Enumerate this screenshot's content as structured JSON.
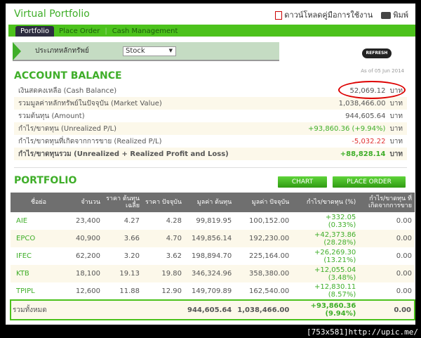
{
  "header": {
    "title": "Virtual Portfolio",
    "download_manual": "ดาวน์โหลดคู่มือการใช้งาน",
    "print": "พิมพ์"
  },
  "nav": {
    "tabs": [
      {
        "label": "Portfolio",
        "active": true
      },
      {
        "label": "Place Order"
      },
      {
        "label": "Cash Management"
      }
    ]
  },
  "filter": {
    "label": "ประเภทหลักทรัพย์",
    "selected": "Stock",
    "refresh": "REFRESH"
  },
  "account": {
    "heading": "ACCOUNT BALANCE",
    "as_of": "As of 05 Jun 2014",
    "unit": "บาท",
    "rows": [
      {
        "label": "เงินสดคงเหลือ (Cash Balance)",
        "value": "52,069.12"
      },
      {
        "label": "รวมมูลค่าหลักทรัพย์ในปัจจุบัน (Market Value)",
        "value": "1,038,466.00"
      },
      {
        "label": "รวมต้นทุน (Amount)",
        "value": "944,605.64"
      },
      {
        "label": "กำไร/ขาดทุน (Unrealized P/L)",
        "value": "+93,860.36 (+9.94%)"
      },
      {
        "label": "กำไร/ขาดทุนที่เกิดจากการขาย (Realized P/L)",
        "value": "-5,032.22"
      },
      {
        "label": "กำไร/ขาดทุนรวม (Unrealized + Realized Profit and Loss)",
        "value": "+88,828.14"
      }
    ]
  },
  "portfolio": {
    "heading": "PORTFOLIO",
    "chart_button": "CHART",
    "place_order_button": "PLACE ORDER",
    "columns": [
      "ชื่อย่อ",
      "จำนวน",
      "ราคา ต้นทุนเฉลี่ย",
      "ราคา ปัจจุบัน",
      "มูลค่า ต้นทุน",
      "มูลค่า ปัจจุบัน",
      "กำไร/ขาดทุน (%)",
      "กำไร/ขาดทุน ที่เกิดจากการขาย"
    ],
    "rows": [
      [
        "AIE",
        "23,400",
        "4.27",
        "4.28",
        "99,819.95",
        "100,152.00",
        "+332.05",
        "(0.33%)",
        "0.00"
      ],
      [
        "EPCO",
        "40,900",
        "3.66",
        "4.70",
        "149,856.14",
        "192,230.00",
        "+42,373.86",
        "(28.28%)",
        "0.00"
      ],
      [
        "IFEC",
        "62,200",
        "3.20",
        "3.62",
        "198,894.70",
        "225,164.00",
        "+26,269.30",
        "(13.21%)",
        "0.00"
      ],
      [
        "KTB",
        "18,100",
        "19.13",
        "19.80",
        "346,324.96",
        "358,380.00",
        "+12,055.04",
        "(3.48%)",
        "0.00"
      ],
      [
        "TPIPL",
        "12,600",
        "11.88",
        "12.90",
        "149,709.89",
        "162,540.00",
        "+12,830.11",
        "(8.57%)",
        "0.00"
      ]
    ],
    "total": {
      "label": "รวมทั้งหมด",
      "cost": "944,605.64",
      "market": "1,038,466.00",
      "pl": "+93,860.36",
      "pct": "(9.94%)",
      "realized": "0.00"
    }
  },
  "footer": "[753x581]http://upic.me/",
  "colors": {
    "accent": "#3fae29",
    "nav": "#4cc21c",
    "header_bg": "#6f6f6f",
    "negative": "#e03030",
    "highlight": "#dd0000"
  }
}
